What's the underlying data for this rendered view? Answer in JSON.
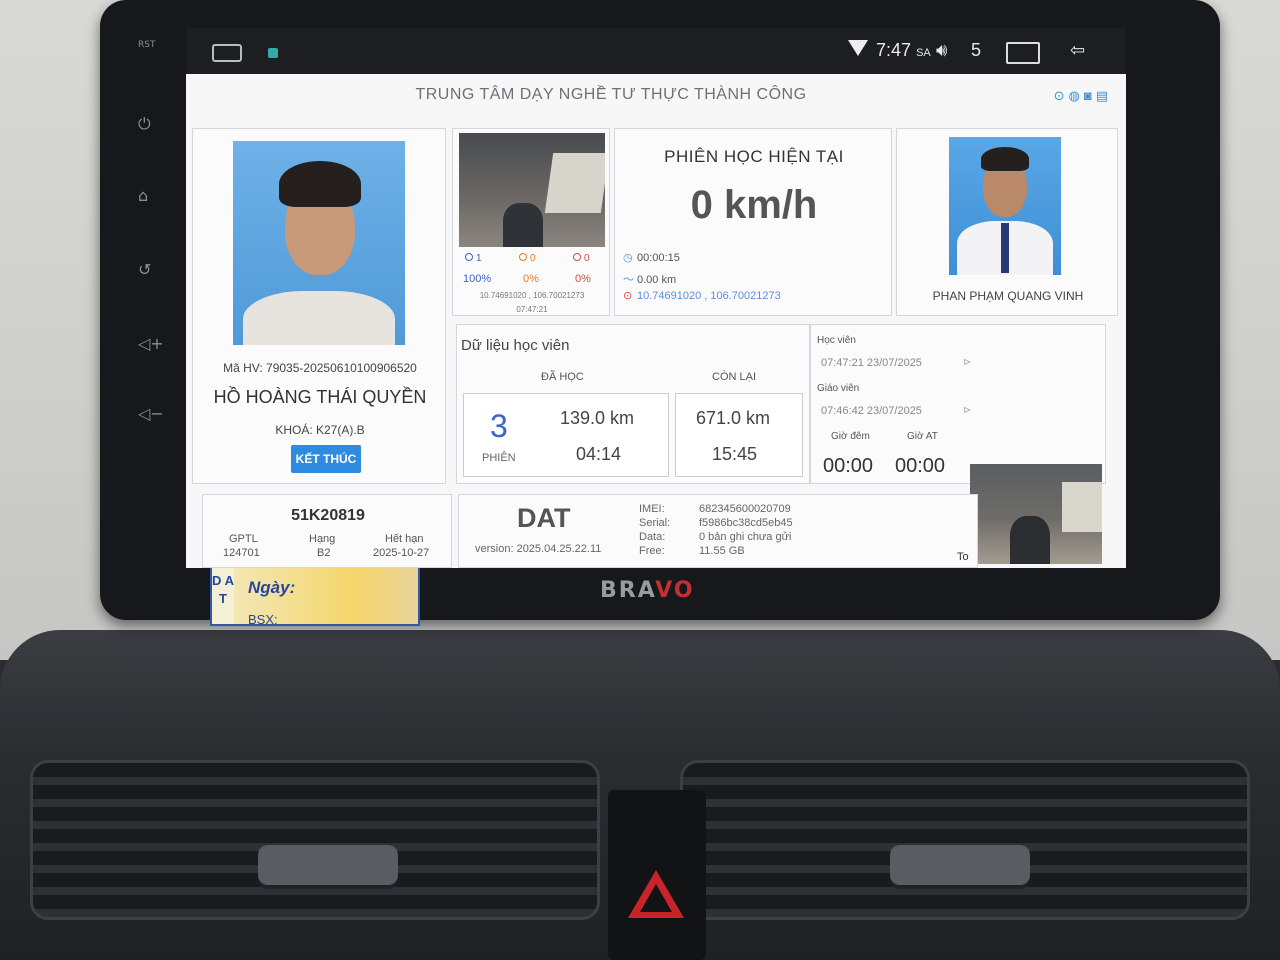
{
  "statusbar": {
    "time": "7:47",
    "time_suffix": "SA",
    "notification_count": "5"
  },
  "app": {
    "title": "TRUNG TÂM DẠY NGHỀ TƯ THỰC THÀNH CÔNG"
  },
  "student": {
    "code": "Mã HV: 79035-20250610100906520",
    "name": "HỒ HOÀNG THÁI QUYỀN",
    "course": "KHOÁ: K27(A).B",
    "end_button": "KẾT THÚC"
  },
  "camera": {
    "stat1_count": "1",
    "stat2_count": "0",
    "stat3_count": "0",
    "stat1_pct": "100%",
    "stat2_pct": "0%",
    "stat3_pct": "0%",
    "coords": "10.74691020 , 106.70021273",
    "time": "07:47:21"
  },
  "session": {
    "title": "PHIÊN HỌC HIỆN TẠI",
    "speed": "0 km/h",
    "duration": "00:00:15",
    "distance": "0.00 km",
    "coords": "10.74691020 , 106.70021273"
  },
  "teacher": {
    "name": "PHAN PHẠM QUANG VINH"
  },
  "student_data": {
    "title": "Dữ liệu học viên",
    "learned_header": "ĐÃ HỌC",
    "remaining_header": "CÒN LẠI",
    "sessions": "3",
    "sessions_label": "PHIÊN",
    "learned_km": "139.0 km",
    "learned_time": "04:14",
    "remaining_km": "671.0 km",
    "remaining_time": "15:45"
  },
  "history": {
    "student_label": "Học viên",
    "student_time": "07:47:21 23/07/2025",
    "teacher_label": "Giáo viên",
    "teacher_time": "07:46:42 23/07/2025",
    "night_label": "Giờ đêm",
    "auto_label": "Giờ AT",
    "night_value": "00:00",
    "auto_value": "00:00",
    "to_label": "To"
  },
  "vehicle": {
    "plate": "51K20819",
    "gptl_label": "GPTL",
    "gptl_value": "124701",
    "rank_label": "Hạng",
    "rank_value": "B2",
    "expiry_label": "Hết hạn",
    "expiry_value": "2025-10-27"
  },
  "device": {
    "name": "DAT",
    "version": "version: 2025.04.25.22.11",
    "imei_label": "IMEI:",
    "serial_label": "Serial:",
    "data_label": "Data:",
    "free_label": "Free:",
    "imei_value": "682345600020709",
    "serial_value": "f5986bc38cd5eb45",
    "data_value": "0 bản ghi chưa gửi",
    "free_value": "11.55 GB"
  },
  "hardware": {
    "brand_prefix": "BRA",
    "brand_suffix": "VO",
    "sticker_date": "Ngày:",
    "sticker_plate": "BSX:",
    "sticker_side": "D A T",
    "side_buttons": [
      "RST",
      "power-icon",
      "home-icon",
      "back-icon",
      "volume-up-icon",
      "volume-down-icon"
    ]
  },
  "colors": {
    "accent_blue": "#2f8be0",
    "session_number": "#3b63c8",
    "coords_blue": "#5b8ed8",
    "gps_red": "#d64a4a"
  }
}
